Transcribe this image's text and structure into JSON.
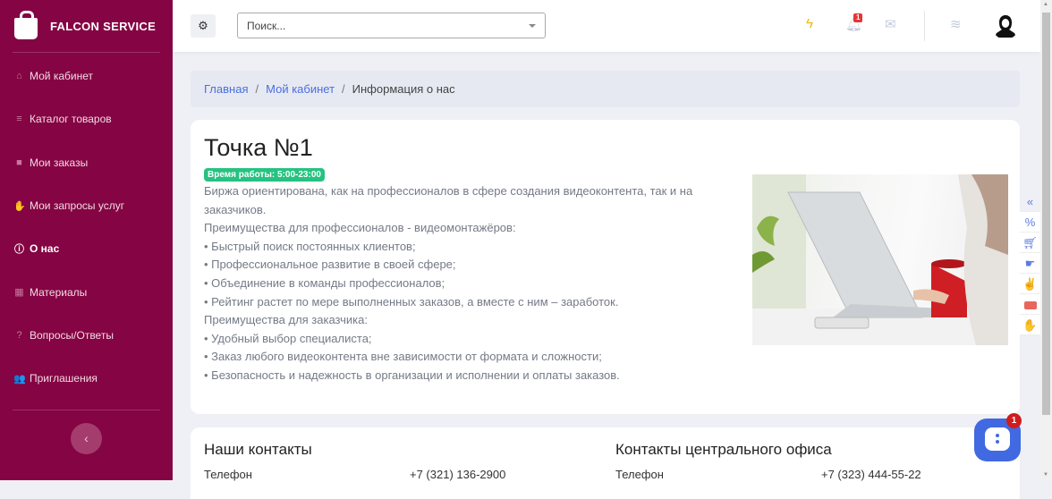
{
  "brand": {
    "name": "FALCON SERVICE",
    "color": "#850443"
  },
  "sidebar": {
    "items": [
      {
        "label": "Мой кабинет",
        "icon": "home-icon"
      },
      {
        "label": "Каталог товаров",
        "icon": "list-icon"
      },
      {
        "label": "Мои заказы",
        "icon": "briefcase-icon"
      },
      {
        "label": "Мои запросы услуг",
        "icon": "hand-icon"
      },
      {
        "label": "О нас",
        "icon": "info-icon",
        "active": true
      },
      {
        "label": "Материалы",
        "icon": "cubes-icon"
      },
      {
        "label": "Вопросы/Ответы",
        "icon": "question-icon"
      },
      {
        "label": "Приглашения",
        "icon": "users-icon"
      }
    ]
  },
  "header": {
    "search_placeholder": "Поиск...",
    "notifications_count": "1"
  },
  "breadcrumb": {
    "items": [
      "Главная",
      "Мой кабинет"
    ],
    "current": "Информация о нас"
  },
  "point": {
    "title": "Точка №1",
    "hours": "Время работы: 5:00-23:00",
    "lines": [
      "Биржа ориентирована, как на профессионалов в сфере создания видеоконтента, так и на заказчиков.",
      "Преимущества для профессионалов - видеомонтажёров:",
      "• Быстрый поиск постоянных клиентов;",
      "• Профессиональное развитие в своей сфере;",
      "• Объединение в команды профессионалов;",
      "• Рейтинг растет по мере выполненных заказов, а вместе с ним – заработок.",
      "Преимущества для заказчика:",
      "• Удобный выбор специалиста;",
      "• Заказ любого видеоконтента вне зависимости от формата и сложности;",
      "• Безопасность и надежность в организации и исполнении и оплаты заказов."
    ]
  },
  "contacts": {
    "ours": {
      "title": "Наши контакты",
      "phone_label": "Телефон",
      "phone": "+7 (321) 136-2900"
    },
    "office": {
      "title": "Контакты центрального офиса",
      "phone_label": "Телефон",
      "phone": "+7 (323) 444-55-22"
    }
  },
  "chat": {
    "badge": "1"
  }
}
